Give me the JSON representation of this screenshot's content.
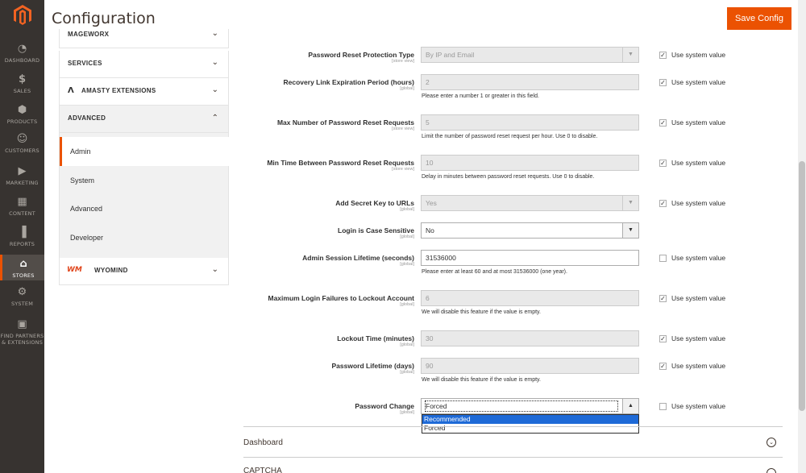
{
  "admin_nav": {
    "items": [
      {
        "label": "DASHBOARD",
        "icon": "dashboard-icon"
      },
      {
        "label": "SALES",
        "icon": "dollar-icon"
      },
      {
        "label": "PRODUCTS",
        "icon": "cube-icon"
      },
      {
        "label": "CUSTOMERS",
        "icon": "person-icon"
      },
      {
        "label": "MARKETING",
        "icon": "megaphone-icon"
      },
      {
        "label": "CONTENT",
        "icon": "layout-icon"
      },
      {
        "label": "REPORTS",
        "icon": "bar-chart-icon"
      },
      {
        "label": "STORES",
        "icon": "store-icon"
      },
      {
        "label": "SYSTEM",
        "icon": "gear-icon"
      },
      {
        "label": "FIND PARTNERS & EXTENSIONS",
        "icon": "blocks-icon"
      }
    ],
    "active": "STORES",
    "accent": "#eb5202"
  },
  "header": {
    "title": "Configuration",
    "save_label": "Save Config"
  },
  "cfg_nav": {
    "sections": [
      "MAGEWORX",
      "SERVICES",
      "AMASTY EXTENSIONS",
      "ADVANCED",
      "WYOMIND"
    ],
    "advanced_items": [
      "Admin",
      "System",
      "Advanced",
      "Developer"
    ],
    "selected": "Admin"
  },
  "form": {
    "use_system_value_label": "Use system value",
    "rows": [
      {
        "label": "Password Reset Protection Type",
        "scope": "[store view]",
        "value": "By IP and Email",
        "type": "select",
        "note": "",
        "use_system": true
      },
      {
        "label": "Recovery Link Expiration Period (hours)",
        "scope": "[global]",
        "value": "2",
        "type": "text",
        "note": "Please enter a number 1 or greater in this field.",
        "use_system": true
      },
      {
        "label": "Max Number of Password Reset Requests",
        "scope": "[store view]",
        "value": "5",
        "type": "text",
        "note": "Limit the number of password reset request per hour. Use 0 to disable.",
        "use_system": true
      },
      {
        "label": "Min Time Between Password Reset Requests",
        "scope": "[store view]",
        "value": "10",
        "type": "text",
        "note": "Delay in minutes between password reset requests. Use 0 to disable.",
        "use_system": true
      },
      {
        "label": "Add Secret Key to URLs",
        "scope": "[global]",
        "value": "Yes",
        "type": "select",
        "note": "",
        "use_system": true
      },
      {
        "label": "Login is Case Sensitive",
        "scope": "[global]",
        "value": "No",
        "type": "select",
        "note": "",
        "use_system": false,
        "hide_usys": true
      },
      {
        "label": "Admin Session Lifetime (seconds)",
        "scope": "[global]",
        "value": "31536000",
        "type": "text",
        "note": "Please enter at least 60 and at most 31536000 (one year).",
        "use_system": false
      },
      {
        "label": "Maximum Login Failures to Lockout Account",
        "scope": "[global]",
        "value": "6",
        "type": "text",
        "note": "We will disable this feature if the value is empty.",
        "use_system": true
      },
      {
        "label": "Lockout Time (minutes)",
        "scope": "[global]",
        "value": "30",
        "type": "text",
        "note": "",
        "use_system": true
      },
      {
        "label": "Password Lifetime (days)",
        "scope": "[global]",
        "value": "90",
        "type": "text",
        "note": "We will disable this feature if the value is empty.",
        "use_system": true
      },
      {
        "label": "Password Change",
        "scope": "[global]",
        "value": "Forced",
        "type": "select",
        "note": "",
        "use_system": false
      }
    ],
    "dropdown_options": [
      "Recommended",
      "Forced"
    ],
    "highlighted_option": "Recommended"
  },
  "sections_below": [
    "Dashboard",
    "CAPTCHA"
  ]
}
